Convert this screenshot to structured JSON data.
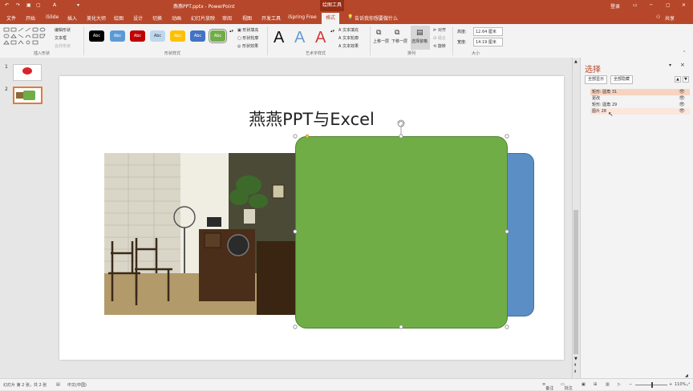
{
  "window": {
    "title": "燕燕PPT.pptx - PowerPoint",
    "context_tool": "绘图工具",
    "login": "登录",
    "share": "共享"
  },
  "tabs": [
    "文件",
    "开始",
    "iSlide",
    "插入",
    "美化大师",
    "绘图",
    "设计",
    "切换",
    "动画",
    "幻灯片放映",
    "审阅",
    "视图",
    "开发工具",
    "iSpring Free",
    "格式"
  ],
  "tell_me": "告诉我你想要做什么",
  "ribbon": {
    "insert_shapes": {
      "label": "插入形状",
      "edit_shape": "编辑形状",
      "text_box": "文本框",
      "merge_shapes": "合并形状"
    },
    "shape_styles": {
      "label": "形状样式",
      "swatch_text": "Abc",
      "fill": "形状填充",
      "outline": "形状轮廓",
      "effects": "形状效果"
    },
    "wordart": {
      "label": "艺术字样式",
      "glyph": "A",
      "text_fill": "文本填充",
      "text_outline": "文本轮廓",
      "text_effects": "文本效果"
    },
    "arrange": {
      "label": "排列",
      "bring_forward": "上移一层",
      "send_backward": "下移一层",
      "selection_pane": "选择窗格",
      "align": "对齐",
      "group": "组合",
      "rotate": "旋转"
    },
    "size": {
      "label": "大小",
      "height_label": "高度:",
      "height_value": "12.64 厘米",
      "width_label": "宽度:",
      "width_value": "14.19 厘米"
    }
  },
  "swatch_colors": [
    "#000000",
    "#5b9bd5",
    "#c00000",
    "#bdd7ee",
    "#ffc000",
    "#4472c4",
    "#70ad47"
  ],
  "slides": [
    {
      "number": "1"
    },
    {
      "number": "2"
    }
  ],
  "slide": {
    "title": "燕燕PPT与Excel",
    "green_shape_color": "#70ad47",
    "blue_shape_color": "#5b8ec4"
  },
  "selection_pane": {
    "title": "选择",
    "show_all": "全部显示",
    "hide_all": "全部隐藏",
    "items": [
      {
        "label": "矩形: 圆角 31",
        "highlight": true
      },
      {
        "label": "更改",
        "highlight": false
      },
      {
        "label": "矩形: 圆角 29",
        "highlight": false
      },
      {
        "label": "图片 28",
        "highlight": true
      }
    ]
  },
  "status": {
    "slide_info": "幻灯片 第 2 张，共 2 张",
    "language": "中文(中国)",
    "notes": "备注",
    "comments": "批注",
    "zoom": "110%"
  }
}
